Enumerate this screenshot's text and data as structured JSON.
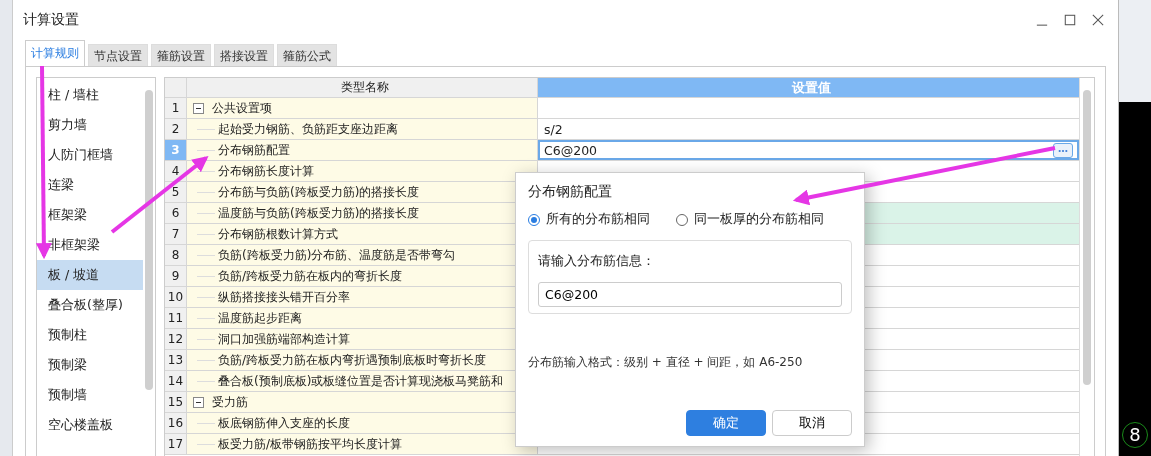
{
  "window": {
    "title": "计算设置"
  },
  "tabs": [
    {
      "label": "计算规则",
      "selected": true
    },
    {
      "label": "节点设置",
      "selected": false
    },
    {
      "label": "箍筋设置",
      "selected": false
    },
    {
      "label": "搭接设置",
      "selected": false
    },
    {
      "label": "箍筋公式",
      "selected": false
    }
  ],
  "categories": [
    {
      "label": "柱 / 墙柱",
      "selected": false
    },
    {
      "label": "剪力墙",
      "selected": false
    },
    {
      "label": "人防门框墙",
      "selected": false
    },
    {
      "label": "连梁",
      "selected": false
    },
    {
      "label": "框架梁",
      "selected": false
    },
    {
      "label": "非框架梁",
      "selected": false
    },
    {
      "label": "板 / 坡道",
      "selected": true
    },
    {
      "label": "叠合板(整厚)",
      "selected": false
    },
    {
      "label": "预制柱",
      "selected": false
    },
    {
      "label": "预制梁",
      "selected": false
    },
    {
      "label": "预制墙",
      "selected": false
    },
    {
      "label": "空心楼盖板",
      "selected": false
    }
  ],
  "table": {
    "columns": [
      "类型名称",
      "设置值"
    ],
    "rows": [
      {
        "number": "1",
        "name": "公共设置项",
        "expanded": true,
        "selected": false,
        "highlighted": false,
        "children": [
          {
            "number": "2",
            "name": "起始受力钢筋、负筋距支座边距离",
            "value": "s/2",
            "selected": false,
            "highlighted": false
          },
          {
            "number": "3",
            "name": "分布钢筋配置",
            "value": "C6@200",
            "selected": true,
            "highlighted": false
          },
          {
            "number": "4",
            "name": "分布钢筋长度计算",
            "selected": false,
            "highlighted": false
          },
          {
            "number": "5",
            "name": "分布筋与负筋(跨板受力筋)的搭接长度",
            "selected": false,
            "highlighted": false
          },
          {
            "number": "6",
            "name": "温度筋与负筋(跨板受力筋)的搭接长度",
            "selected": false,
            "highlighted": true
          },
          {
            "number": "7",
            "name": "分布钢筋根数计算方式",
            "selected": false,
            "highlighted": true
          },
          {
            "number": "8",
            "name": "负筋(跨板受力筋)分布筋、温度筋是否带弯勾",
            "selected": false,
            "highlighted": false
          },
          {
            "number": "9",
            "name": "负筋/跨板受力筋在板内的弯折长度",
            "selected": false,
            "highlighted": false
          },
          {
            "number": "10",
            "name": "纵筋搭接接头错开百分率",
            "selected": false,
            "highlighted": false
          },
          {
            "number": "11",
            "name": "温度筋起步距离",
            "selected": false,
            "highlighted": false
          },
          {
            "number": "12",
            "name": "洞口加强筋端部构造计算",
            "selected": false,
            "highlighted": false
          },
          {
            "number": "13",
            "name": "负筋/跨板受力筋在板内弯折遇预制底板时弯折长度",
            "selected": false,
            "highlighted": false
          },
          {
            "number": "14",
            "name": "叠合板(预制底板)或板缝位置是否计算现浇板马凳筋和",
            "selected": false,
            "highlighted": false
          }
        ]
      },
      {
        "number": "15",
        "name": "受力筋",
        "expanded": true,
        "selected": false,
        "highlighted": false,
        "children": [
          {
            "number": "16",
            "name": "板底钢筋伸入支座的长度",
            "selected": false,
            "highlighted": false
          },
          {
            "number": "17",
            "name": "板受力筋/板带钢筋按平均长度计算",
            "selected": false,
            "highlighted": false
          }
        ]
      }
    ]
  },
  "dialog": {
    "title": "分布钢筋配置",
    "options": [
      {
        "label": "所有的分布筋相同",
        "selected": true
      },
      {
        "label": "同一板厚的分布筋相同",
        "selected": false
      }
    ],
    "group_label": "请输入分布筋信息：",
    "input": {
      "value": "C6@200"
    },
    "hint": "分布筋输入格式：级别 + 直径 + 间距，如 A6-250",
    "buttons": [
      {
        "label": "确定",
        "kind": "primary"
      },
      {
        "label": "取消",
        "kind": "secondary"
      }
    ]
  },
  "canvas": {
    "marker": "8"
  }
}
